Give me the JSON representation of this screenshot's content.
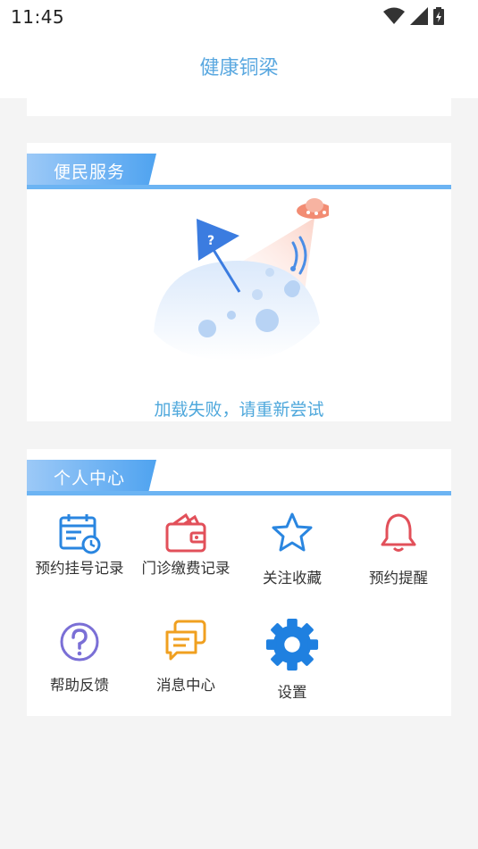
{
  "status_bar": {
    "time": "11:45",
    "icons": [
      "wifi-icon",
      "signal-icon",
      "battery-icon"
    ]
  },
  "header": {
    "title": "健康铜梁"
  },
  "services": {
    "section_label": "便民服务",
    "error_message": "加载失败，请重新尝试"
  },
  "personal": {
    "section_label": "个人中心",
    "items": [
      {
        "label": "预约挂号记录",
        "icon": "calendar-clock-icon",
        "color": "#2a86e0"
      },
      {
        "label": "门诊缴费记录",
        "icon": "wallet-icon",
        "color": "#e2505a"
      },
      {
        "label": "关注收藏",
        "icon": "star-icon",
        "color": "#2a86e0"
      },
      {
        "label": "预约提醒",
        "icon": "bell-icon",
        "color": "#e2505a"
      },
      {
        "label": "帮助反馈",
        "icon": "question-circle-icon",
        "color": "#7a6fd6"
      },
      {
        "label": "消息中心",
        "icon": "chat-icon",
        "color": "#f0a020"
      },
      {
        "label": "设置",
        "icon": "gear-icon",
        "color": "#2a86e0"
      }
    ]
  }
}
